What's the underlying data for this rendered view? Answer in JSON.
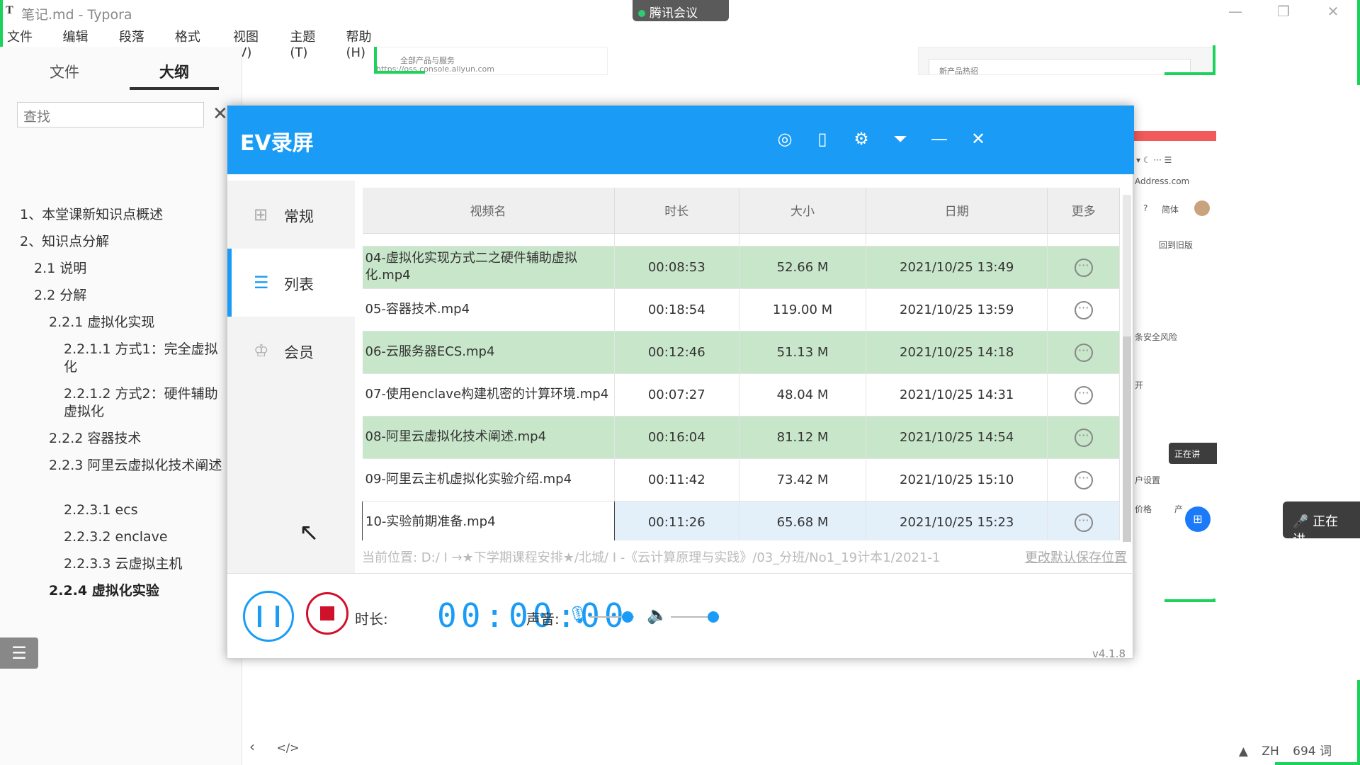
{
  "typora": {
    "app_icon": "T",
    "window_title": "笔记.md - Typora",
    "menus": [
      "文件(F)",
      "编辑(E)",
      "段落(P)",
      "格式(O)",
      "视图(V)",
      "主题(T)",
      "帮助(H)"
    ],
    "sidebar": {
      "tab_files": "文件",
      "tab_outline": "大纲",
      "search_placeholder": "查找",
      "outline": [
        "1、本堂课新知识点概述",
        "2、知识点分解",
        "2.1 说明",
        "2.2 分解",
        "2.2.1 虚拟化实现",
        "2.2.1.1 方式1：完全虚拟化",
        "2.2.1.2 方式2：硬件辅助虚拟化",
        "2.2.2 容器技术",
        "2.2.3 阿里云虚拟化技术阐述",
        "2.2.3.1 ecs",
        "2.2.3.2 enclave",
        "2.2.3.3 云虚拟主机",
        "2.2.4 虚拟化实验"
      ]
    },
    "status": {
      "lang": "ZH",
      "word_count": "694 词"
    }
  },
  "meeting": {
    "label": "腾讯会议"
  },
  "background": {
    "frag1_title": "全部产品与服务",
    "frag1_url": "https://oss.console.aliyun.com",
    "frag2_text": "新产品热招",
    "right_browser": {
      "address": "Address.com",
      "simplified": "简体",
      "back_old": "回到旧版",
      "security_risk": "条安全风险",
      "expand": "开",
      "settings": "户设置",
      "price": "价格",
      "product": "产",
      "talking": "正在讲"
    },
    "talk_pill": "正在讲"
  },
  "ev": {
    "logo": "EV录屏",
    "nav": [
      "常规",
      "列表",
      "会员"
    ],
    "columns": [
      "视频名",
      "时长",
      "大小",
      "日期",
      "更多"
    ],
    "rows": [
      {
        "name": "04-虚拟化实现方式二之硬件辅助虚拟化.mp4",
        "duration": "00:08:53",
        "size": "52.66 M",
        "date": "2021/10/25 13:49"
      },
      {
        "name": "05-容器技术.mp4",
        "duration": "00:18:54",
        "size": "119.00 M",
        "date": "2021/10/25 13:59"
      },
      {
        "name": "06-云服务器ECS.mp4",
        "duration": "00:12:46",
        "size": "51.13 M",
        "date": "2021/10/25 14:18"
      },
      {
        "name": "07-使用enclave构建机密的计算环境.mp4",
        "duration": "00:07:27",
        "size": "48.04 M",
        "date": "2021/10/25 14:31"
      },
      {
        "name": "08-阿里云虚拟化技术阐述.mp4",
        "duration": "00:16:04",
        "size": "81.12 M",
        "date": "2021/10/25 14:54"
      },
      {
        "name": "09-阿里云主机虚拟化实验介绍.mp4",
        "duration": "00:11:42",
        "size": "73.42 M",
        "date": "2021/10/25 15:10"
      },
      {
        "name": "10-实验前期准备.mp4",
        "duration": "00:11:26",
        "size": "65.68 M",
        "date": "2021/10/25 15:23"
      }
    ],
    "path_text": "当前位置: D:/ I →★下学期课程安排★/北城/ I -《云计算原理与实践》/03_分班/No1_19计本1/2021-1",
    "change_path": "更改默认保存位置",
    "duration_label": "时长:",
    "timer": "00:00:00",
    "sound_label": "声音:",
    "version": "v4.1.8",
    "mic_level": 0.85,
    "speaker_level": 1.0
  }
}
